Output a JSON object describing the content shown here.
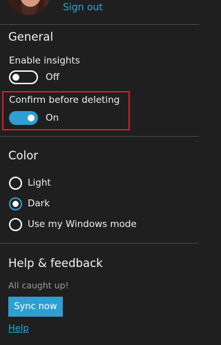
{
  "account": {
    "signout_label": "Sign out"
  },
  "general": {
    "title": "General",
    "insights": {
      "label": "Enable insights",
      "state": "Off"
    },
    "confirm_delete": {
      "label": "Confirm before deleting",
      "state": "On"
    }
  },
  "color": {
    "title": "Color",
    "options": [
      {
        "label": "Light",
        "selected": false
      },
      {
        "label": "Dark",
        "selected": true
      },
      {
        "label": "Use my Windows mode",
        "selected": false
      }
    ]
  },
  "help": {
    "title": "Help & feedback",
    "status": "All caught up!",
    "sync_label": "Sync now",
    "help_link": "Help"
  },
  "colors": {
    "background": "#1f1f1f",
    "accent": "#2d9fd1",
    "highlight_border": "#d3202a"
  }
}
